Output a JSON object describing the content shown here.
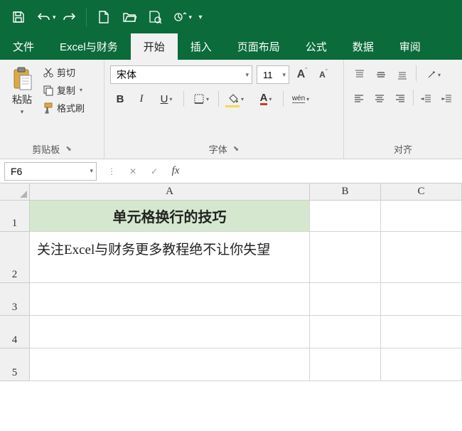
{
  "qat_items": [
    "save",
    "undo",
    "redo",
    "new",
    "open",
    "print-preview",
    "touch-mode",
    "overflow"
  ],
  "tabs": {
    "file": "文件",
    "custom": "Excel与财务",
    "home": "开始",
    "insert": "插入",
    "layout": "页面布局",
    "formulas": "公式",
    "data": "数据",
    "review": "审阅"
  },
  "active_tab": "home",
  "clipboard": {
    "paste": "粘贴",
    "cut": "剪切",
    "copy": "复制",
    "format_painter": "格式刷",
    "group_title": "剪贴板"
  },
  "font": {
    "name": "宋体",
    "size": "11",
    "group_title": "字体",
    "bold": "B",
    "italic": "I",
    "underline": "U",
    "phonetic": "wén"
  },
  "alignment": {
    "group_title": "对齐"
  },
  "formula_bar": {
    "name_box": "F6",
    "fx": "fx",
    "value": ""
  },
  "columns": {
    "A": "A",
    "B": "B",
    "C": "C"
  },
  "rows": {
    "r1": "1",
    "r2": "2",
    "r3": "3",
    "r4": "4",
    "r5": "5"
  },
  "cells": {
    "A1": "单元格换行的技巧",
    "A2": "关注Excel与财务更多教程绝不让你失望"
  },
  "colors": {
    "brand": "#0b6b3a",
    "ribbon_bg": "#f1f1f1",
    "a1_bg": "#d5e8cf",
    "font_color_indicator": "#d23a2b",
    "fill_color_indicator": "#f5d94f"
  }
}
